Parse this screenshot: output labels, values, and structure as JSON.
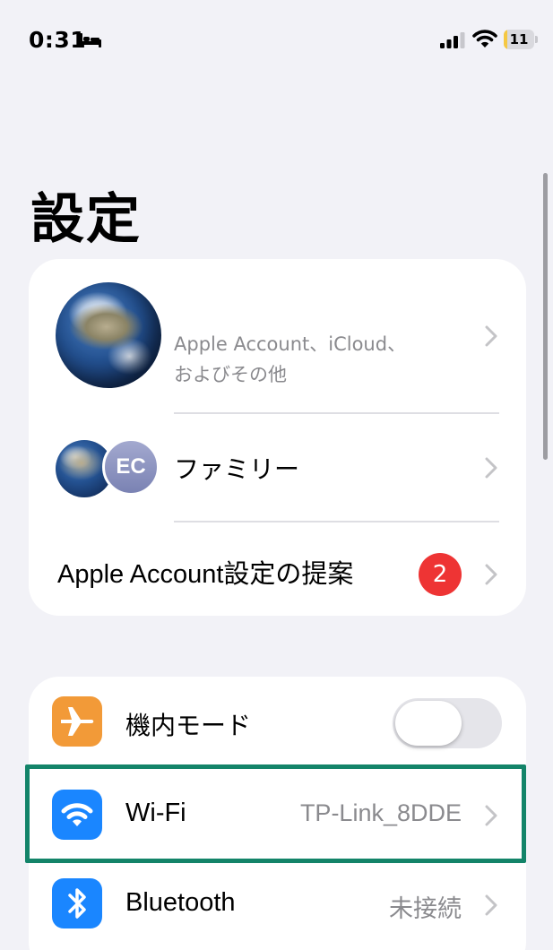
{
  "status_bar": {
    "time": "0:31",
    "battery_level": "11",
    "battery_fraction": 0.11,
    "icons": [
      "bed-icon",
      "cellular-signal-icon",
      "wifi-icon",
      "battery-icon"
    ]
  },
  "title": "設定",
  "account_card": {
    "profile": {
      "subtitle_line1": "Apple Account、iCloud、",
      "subtitle_line2": "およびその他"
    },
    "family": {
      "label": "ファミリー",
      "avatar_initials": "EC"
    },
    "suggestions": {
      "label": "Apple Account設定の提案",
      "badge": "2"
    }
  },
  "settings": [
    {
      "id": "airplane",
      "label": "機内モード",
      "icon": "airplane-icon",
      "toggle_on": false
    },
    {
      "id": "wifi",
      "label": "Wi-Fi",
      "value": "TP-Link_8DDE",
      "icon": "wifi-icon"
    },
    {
      "id": "bluetooth",
      "label": "Bluetooth",
      "value": "未接続",
      "icon": "bluetooth-icon"
    }
  ],
  "colors": {
    "background": "#f2f2f7",
    "badge": "#ee3434",
    "airplane_icon_bg": "#f29a38",
    "blue_icon_bg": "#1a86ff",
    "highlight": "#138469",
    "battery_fill": "#f5c842"
  }
}
